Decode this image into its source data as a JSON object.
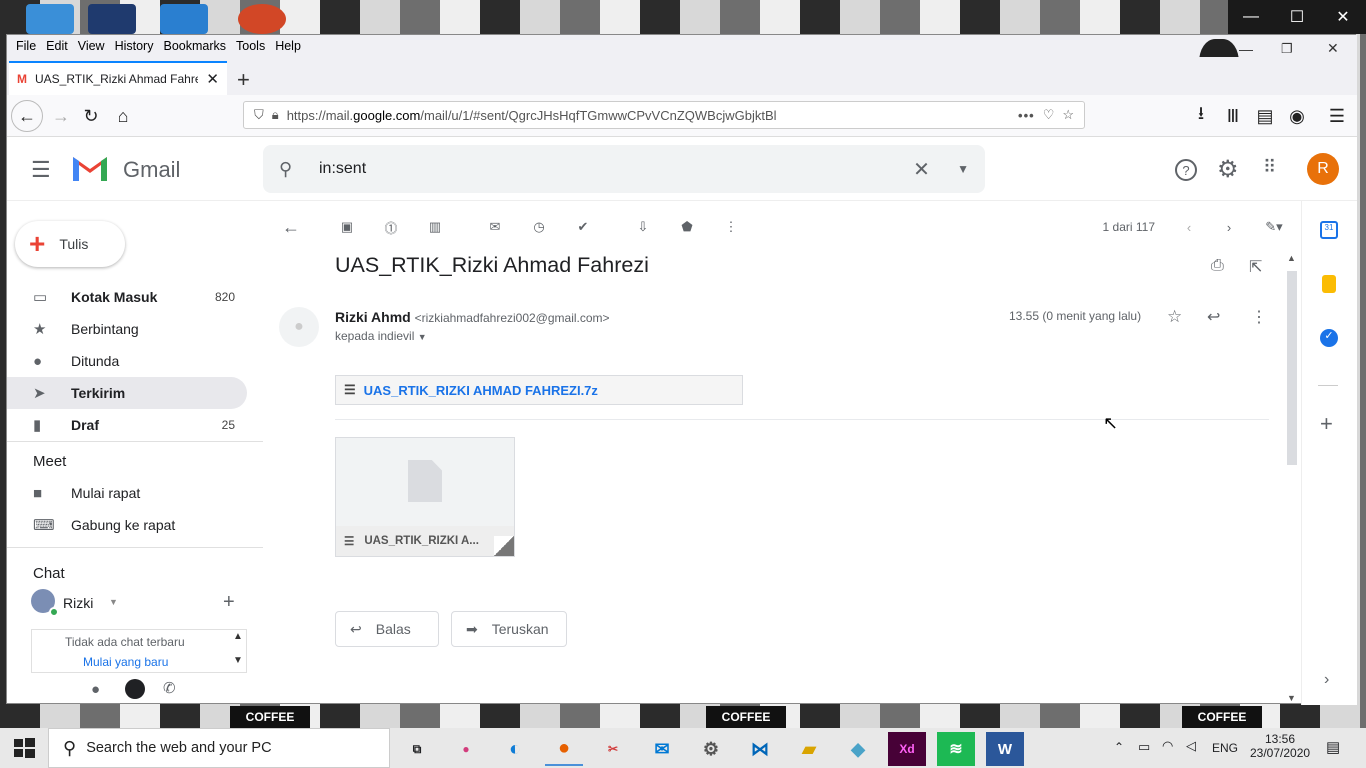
{
  "browser": {
    "menu": [
      "File",
      "Edit",
      "View",
      "History",
      "Bookmarks",
      "Tools",
      "Help"
    ],
    "tab_title": "UAS_RTIK_Rizki Ahmad Fahrezi",
    "url_prefix": "https://mail.",
    "url_domain": "google.com",
    "url_suffix": "/mail/u/1/#sent/QgrcJHsHqfTGmwwCPvVCnZQWBcjwGbjktBl"
  },
  "gmail": {
    "logo_text": "Gmail",
    "search_value": "in:sent",
    "avatar_letter": "R",
    "compose_label": "Tulis",
    "nav": [
      {
        "label": "Kotak Masuk",
        "count": "820"
      },
      {
        "label": "Berbintang",
        "count": ""
      },
      {
        "label": "Ditunda",
        "count": ""
      },
      {
        "label": "Terkirim",
        "count": ""
      },
      {
        "label": "Draf",
        "count": "25"
      }
    ],
    "meet": {
      "title": "Meet",
      "items": [
        "Mulai rapat",
        "Gabung ke rapat"
      ]
    },
    "chat": {
      "title": "Chat",
      "user": "Rizki",
      "empty_text": "Tidak ada chat terbaru",
      "start_link": "Mulai yang baru"
    },
    "pagination": "1 dari 117",
    "subject": "UAS_RTIK_Rizki Ahmad Fahrezi",
    "sender_name": "Rizki Ahmd",
    "sender_email": "<rizkiahmadfahrezi002@gmail.com>",
    "recipient": "kepada indievil",
    "time": "13.55 (0 menit yang lalu)",
    "attachment_name": "UAS_RTIK_RIZKI AHMAD FAHREZI.7z",
    "attachment_thumb_label": "UAS_RTIK_RIZKI A...",
    "reply_label": "Balas",
    "forward_label": "Teruskan"
  },
  "taskbar": {
    "search_placeholder": "Search the web and your PC",
    "lang": "ENG",
    "time": "13:56",
    "date": "23/07/2020"
  },
  "desktop": {
    "strip_label": "COFFEE"
  }
}
